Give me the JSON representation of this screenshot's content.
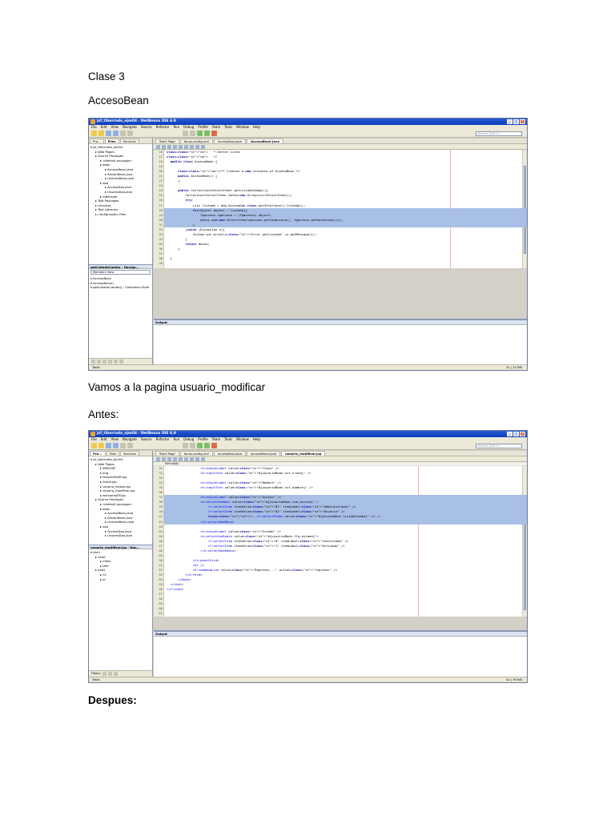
{
  "headings": {
    "h1": "Clase 3",
    "h2": "AccesoBean",
    "h3": "Vamos a la pagina usuario_modificar",
    "h4": "Antes:",
    "h5": "Despues:"
  },
  "colors": {
    "titlebar": "#0b3cb8",
    "selection": "#a8bfe6",
    "keyword": "#00009c"
  },
  "ide1": {
    "title": "jsf_tiberrado_ejm04 - NetBeans IDE 6.9",
    "menu": [
      "File",
      "Edit",
      "View",
      "Navigate",
      "Source",
      "Refactor",
      "Run",
      "Debug",
      "Profile",
      "Team",
      "Tools",
      "Window",
      "Help"
    ],
    "search_placeholder": "Search (Ctrl+I)",
    "pane_tabs": [
      "Pro...",
      "Files",
      "Services"
    ],
    "tree": [
      "jsf_tiberrado_ejm04",
      "  Web Pages",
      "  Source Packages",
      "    <default package>",
      "    bean",
      "      AccesoBean.java",
      "      SesionBean.java",
      "      UsuarioBean.java",
      "    dao",
      "      AccesoDao.java",
      "      UsuarioDao.java",
      "    hibernate",
      "  Test Packages",
      "  Libraries",
      "  Test Libraries",
      "  Configuration Files"
    ],
    "navigator_title": "getListadoCombo - Naviga...",
    "navigator_select": "Members View",
    "navigator_items": [
      "AccesoBean",
      "AccesoBean()",
      "getListadoCombo() : Collection<Sele"
    ],
    "editor_tabs": [
      "Start Page",
      "faces-config.xml",
      "AccesoDao.java",
      "AccesoBean.java"
    ],
    "code": [
      {
        "n": "16",
        "t": "   * Getter Lista"
      },
      {
        "n": "17",
        "t": "   */"
      },
      {
        "n": "18",
        "t": "  public class AccesoBean {"
      },
      {
        "n": "19",
        "t": ""
      },
      {
        "n": "20",
        "t": "      /** Creates a new instance of AccesoBean */"
      },
      {
        "n": "21",
        "t": "      public AccesoBean() {"
      },
      {
        "n": "22",
        "t": "      }"
      },
      {
        "n": "23",
        "t": ""
      },
      {
        "n": "24",
        "t": "      public Collection<SelectItem> getListadoCombo(){"
      },
      {
        "n": "25",
        "t": "          Collection<SelectItem> datos=new ArrayList<SelectItem>();"
      },
      {
        "n": "26",
        "t": "          try{"
      },
      {
        "n": "27",
        "t": "              List listado = dao.AccesoDao.class.getInterface().listado();"
      },
      {
        "n": "28",
        "t": "              for(Object object : listado){",
        "sel": true
      },
      {
        "n": "29",
        "t": "                  Tgacceso tgacceso = (Tgacceso) object;",
        "sel": true
      },
      {
        "n": "30",
        "t": "                  datos.add(new SelectItem(tgacceso.getCodacceso(), tgacceso.getDetacceso()));",
        "sel": true
      },
      {
        "n": "31",
        "t": "              }",
        "sel": true
      },
      {
        "n": "32",
        "t": "          }catch (Exception e){"
      },
      {
        "n": "33",
        "t": "              System.out.println(\"Error getListado\" +e.getMessage());"
      },
      {
        "n": "34",
        "t": "          }"
      },
      {
        "n": "35",
        "t": "          return datos;"
      },
      {
        "n": "36",
        "t": "      }"
      },
      {
        "n": "37",
        "t": ""
      },
      {
        "n": "38",
        "t": "  }"
      },
      {
        "n": "39",
        "t": ""
      }
    ],
    "output_label": "Output",
    "status_left": "Tasks",
    "status_right": "31 | 14    INS"
  },
  "ide2": {
    "title": "jsf_tiberrado_ejm04 - NetBeans IDE 6.9",
    "menu": [
      "File",
      "Edit",
      "View",
      "Navigate",
      "Source",
      "Refactor",
      "Run",
      "Debug",
      "Profile",
      "Team",
      "Tools",
      "Window",
      "Help"
    ],
    "search_placeholder": "Search (Ctrl+I)",
    "pane_tabs": [
      "Pro...",
      "Files",
      "Services"
    ],
    "tree": [
      "jsf_tiberrado_ejm04",
      "  Web Pages",
      "    WEB-INF",
      "    img",
      "    forwardToJSF.jsp",
      "    home.jsp",
      "    usuario_listado.jsp",
      "    usuario_modificar.jsp",
      "    welcomeJSF.jsp",
      "  Source Packages",
      "    <default package>",
      "    bean",
      "      AccesoBean.java",
      "      SesionBean.java",
      "      UsuarioBean.java",
      "    dao",
      "      AccesoDao.java",
      "      UsuarioDao.java"
    ],
    "navigator_title": "usuario_modificar.jsp - Nav...",
    "navigator_items": [
      "html",
      "  head",
      "    meta",
      "    title",
      "  body",
      "    h1",
      "    br"
    ],
    "filters_label": "Filters:",
    "editor_tabs": [
      "Start Page",
      "faces-config.xml",
      "AccesoDao.java",
      "AccesoBean.java",
      "usuario_modificar.jsp"
    ],
    "crumb": "html   body",
    "code": [
      {
        "n": "31",
        "t": "                  <h:outputLabel value=\"Clave\" />"
      },
      {
        "n": "32",
        "t": "                  <h:inputText value=\"#{usuarioBean.txt_clave}\" />"
      },
      {
        "n": "33",
        "t": ""
      },
      {
        "n": "34",
        "t": "                  <h:outputLabel value=\"Nombre\" />"
      },
      {
        "n": "35",
        "t": "                  <h:inputText value=\"#{usuarioBean.txt_nombre}\" />"
      },
      {
        "n": "36",
        "t": ""
      },
      {
        "n": "37",
        "t": "                  <h:outputLabel value=\"Acceso\" />",
        "sel": true
      },
      {
        "n": "38",
        "t": "                  <h:selectOneMenu value=\"#{usuarioBean.cod_acceso}\" >",
        "sel": true
      },
      {
        "n": "39",
        "t": "                      <f:selectItem itemValue=\"01\" itemLabel=\"Administrador\" />",
        "sel": true
      },
      {
        "n": "40",
        "t": "                      <f:selectItem itemValue=\"02\" itemLabel=\"Usuario\" />",
        "sel": true
      },
      {
        "n": "41",
        "t": "                      <!--<f:selectItems value=\"#{accesoBean.listadoCombo}\" />-->",
        "sel": true
      },
      {
        "n": "42",
        "t": "                  </h:selectOneMenu>",
        "sel": true
      },
      {
        "n": "43",
        "t": ""
      },
      {
        "n": "44",
        "t": "                  <h:outputLabel value=\"Estado\" />"
      },
      {
        "n": "45",
        "t": "                  <h:selectOneRadio value=\"#{usuarioBean.flg_estado}\">"
      },
      {
        "n": "46",
        "t": "                      <f:selectItem itemValue=\"0\" itemLabel=\"Inactivado\" />"
      },
      {
        "n": "47",
        "t": "                      <f:selectItem itemValue=\"1\" itemLabel=\"Activado\" />"
      },
      {
        "n": "48",
        "t": "                  </h:selectOneRadio>"
      },
      {
        "n": "49",
        "t": ""
      },
      {
        "n": "50",
        "t": "              </h:panelGrid>"
      },
      {
        "n": "51",
        "t": "              <br />"
      },
      {
        "n": "52",
        "t": "              <h:commandLink value=\"Regresar...\" action=\"regresar\" />"
      },
      {
        "n": "53",
        "t": "          </h:form>"
      },
      {
        "n": "54",
        "t": "      </body>"
      },
      {
        "n": "55",
        "t": "  </html>"
      },
      {
        "n": "56",
        "t": "</f:view>"
      },
      {
        "n": "57",
        "t": ""
      },
      {
        "n": "58",
        "t": ""
      },
      {
        "n": "59",
        "t": ""
      },
      {
        "n": "60",
        "t": ""
      },
      {
        "n": "61",
        "t": ""
      }
    ],
    "output_label": "Output",
    "status_left": "Tasks",
    "status_right": "42 | 39    INS"
  }
}
